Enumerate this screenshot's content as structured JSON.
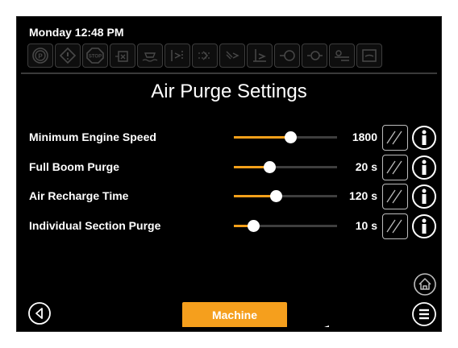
{
  "header": {
    "datetime": "Monday 12:48 PM",
    "status_icons": [
      "parking-brake-icon",
      "warning-icon",
      "stop-icon",
      "tank-icon",
      "boom-icon",
      "left-section-icon",
      "center-section-icon",
      "right-section-icon",
      "boom-height-icon",
      "engine-oil-icon",
      "engine-temp-icon",
      "hydraulic-icon",
      "fuel-gauge-icon"
    ]
  },
  "page": {
    "title": "Air Purge Settings"
  },
  "settings": [
    {
      "label": "Minimum Engine Speed",
      "value": "1800",
      "level": 0.55
    },
    {
      "label": "Full Boom Purge",
      "value": "20 s",
      "level": 0.35
    },
    {
      "label": "Air Recharge Time",
      "value": "120 s",
      "level": 0.41
    },
    {
      "label": "Individual Section Purge",
      "value": "10 s",
      "level": 0.19
    }
  ],
  "footer": {
    "machine_label": "Machine"
  },
  "colors": {
    "accent": "#f59f1d",
    "background": "#000000",
    "text": "#ffffff",
    "track": "#3e3e3e"
  }
}
